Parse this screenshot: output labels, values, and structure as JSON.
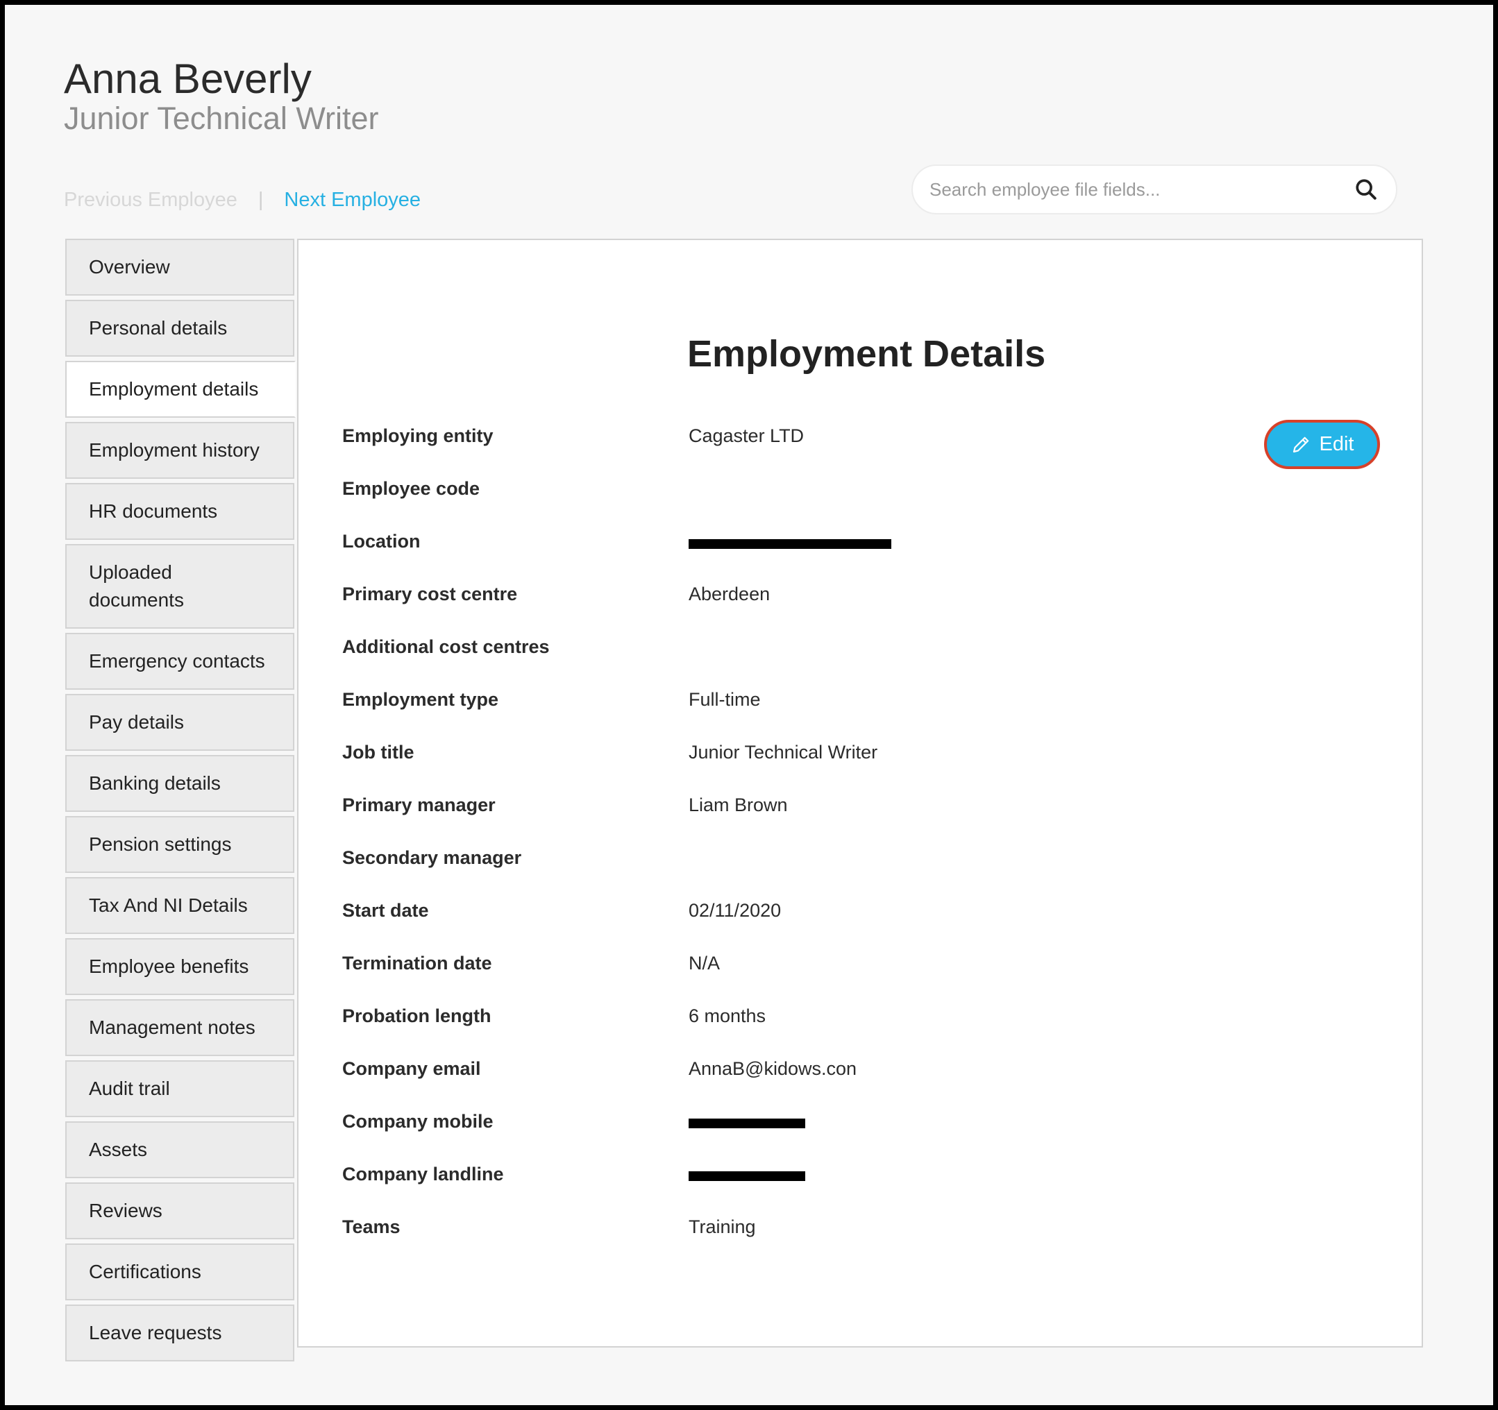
{
  "header": {
    "employee_name": "Anna Beverly",
    "employee_title": "Junior Technical Writer",
    "prev_label": "Previous Employee",
    "separator": "|",
    "next_label": "Next Employee"
  },
  "search": {
    "placeholder": "Search employee file fields...",
    "icon": "search-icon"
  },
  "sidebar": {
    "active_item": "Employment details",
    "items": [
      {
        "label": "Overview"
      },
      {
        "label": "Personal details"
      },
      {
        "label": "Employment details"
      },
      {
        "label": "Employment history"
      },
      {
        "label": "HR documents"
      },
      {
        "label": "Uploaded documents"
      },
      {
        "label": "Emergency contacts"
      },
      {
        "label": "Pay details"
      },
      {
        "label": "Banking details"
      },
      {
        "label": "Pension settings"
      },
      {
        "label": "Tax And NI Details"
      },
      {
        "label": "Employee benefits"
      },
      {
        "label": "Management notes"
      },
      {
        "label": "Audit trail"
      },
      {
        "label": "Assets"
      },
      {
        "label": "Reviews"
      },
      {
        "label": "Certifications"
      },
      {
        "label": "Leave requests"
      }
    ]
  },
  "panel": {
    "title": "Employment Details",
    "edit_label": "Edit",
    "edit_icon": "pencil-icon",
    "fields": [
      {
        "label": "Employing entity",
        "value": "Cagaster LTD"
      },
      {
        "label": "Employee code",
        "value": ""
      },
      {
        "label": "Location",
        "value": "",
        "redacted": true
      },
      {
        "label": "Primary cost centre",
        "value": "Aberdeen"
      },
      {
        "label": "Additional cost centres",
        "value": ""
      },
      {
        "label": "Employment type",
        "value": "Full-time"
      },
      {
        "label": "Job title",
        "value": "Junior Technical Writer"
      },
      {
        "label": "Primary manager",
        "value": "Liam Brown"
      },
      {
        "label": "Secondary manager",
        "value": ""
      },
      {
        "label": "Start date",
        "value": "02/11/2020"
      },
      {
        "label": "Termination date",
        "value": "N/A"
      },
      {
        "label": "Probation length",
        "value": "6 months"
      },
      {
        "label": "Company email",
        "value": "AnnaB@kidows.con"
      },
      {
        "label": "Company mobile",
        "value": "",
        "redacted": true
      },
      {
        "label": "Company landline",
        "value": "",
        "redacted": true
      },
      {
        "label": "Teams",
        "value": "Training"
      }
    ]
  },
  "colors": {
    "accent": "#26b0e2",
    "edit_button_bg": "#25b5e8",
    "edit_button_outline": "#d6412a",
    "muted_link": "#d7d7d7"
  }
}
